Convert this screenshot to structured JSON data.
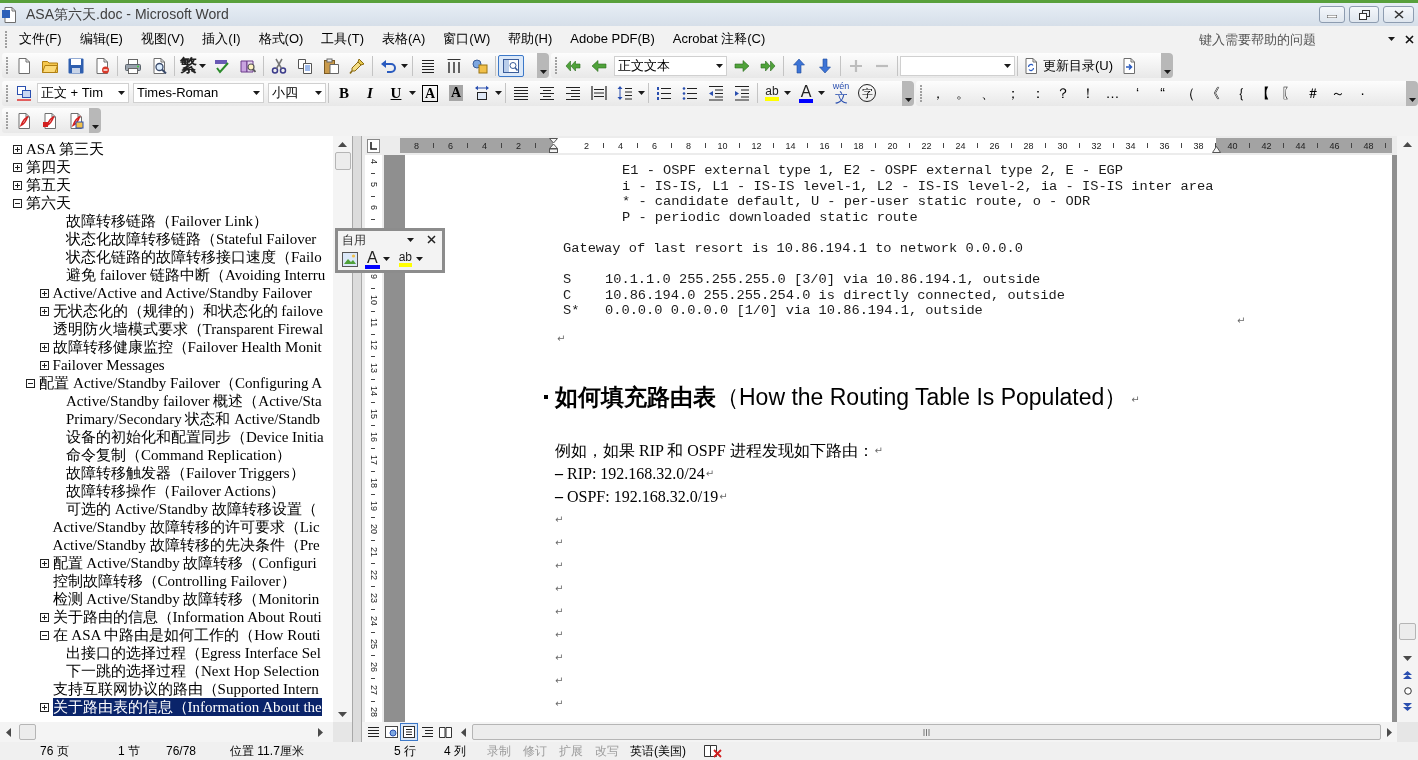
{
  "window": {
    "title": "ASA第六天.doc - Microsoft Word"
  },
  "menu_bar": {
    "items": [
      "文件(F)",
      "编辑(E)",
      "视图(V)",
      "插入(I)",
      "格式(O)",
      "工具(T)",
      "表格(A)",
      "窗口(W)",
      "帮助(H)",
      "Adobe PDF(B)",
      "Acrobat 注释(C)"
    ],
    "help_field": {
      "placeholder": "键入需要帮助的问题"
    }
  },
  "standard_toolbar": {
    "convert_label": "繁",
    "document_map_pressed": true
  },
  "outline_toolbar": {
    "level_style": {
      "value": "正文文本"
    },
    "expand_disabled": true,
    "collapse_disabled": true,
    "update_toc_label": "更新目录(U)"
  },
  "formatting_toolbar": {
    "style": {
      "value": "正文 + Tim"
    },
    "font": {
      "value": "Times-Roman"
    },
    "size": {
      "value": "小四"
    },
    "bold": "B",
    "italic": "I",
    "underline": "U",
    "char_border": "A",
    "char_shading": "A",
    "highlight": "ab",
    "font_color": "A",
    "phonetic_ruby": "wén",
    "phonetic_base": "文",
    "enclose": "字"
  },
  "symbol_toolbar": {
    "symbols": [
      "，",
      "。",
      "、",
      "；",
      "：",
      "？",
      "！",
      "…",
      "‘",
      "“",
      "（",
      "《",
      "｛",
      "【",
      "〖",
      "＃",
      "～",
      "·"
    ]
  },
  "floating_toolbar": {
    "title": "自用",
    "font_color": "A",
    "highlight": "ab"
  },
  "doc_map": {
    "items": [
      {
        "label": "ASA 第三天",
        "expanded": false,
        "selected": false
      },
      {
        "label": "第四天",
        "expanded": false,
        "selected": false
      },
      {
        "label": "第五天",
        "expanded": false,
        "selected": false
      },
      {
        "label": "第六天",
        "expanded": true,
        "selected": false,
        "children": [
          {
            "children": [
              {
                "children": [
                  {
                    "label": "故障转移链路（Failover Link）",
                    "selected": false
                  },
                  {
                    "label": "状态化故障转移链路（Stateful Failover",
                    "selected": false
                  },
                  {
                    "label": "状态化链路的故障转移接口速度（Failo",
                    "selected": false
                  },
                  {
                    "label": "避免 failover 链路中断（Avoiding Interru",
                    "selected": false
                  }
                ]
              },
              {
                "label": "Active/Active and Active/Standby Failover",
                "expanded": false,
                "selected": false
              },
              {
                "label": "无状态化的（规律的）和状态化的 failove",
                "expanded": false,
                "selected": false
              },
              {
                "label": "透明防火墙模式要求（Transparent Firewal",
                "selected": false
              },
              {
                "label": "故障转移健康监控（Failover Health Monit",
                "expanded": false,
                "selected": false
              },
              {
                "label": "Failover Messages",
                "expanded": false,
                "selected": false
              }
            ]
          },
          {
            "label": "配置 Active/Standby Failover（Configuring A",
            "expanded": true,
            "selected": false,
            "children": [
              {
                "children": [
                  {
                    "label": "Active/Standby failover 概述（Active/Sta",
                    "selected": false
                  },
                  {
                    "label": "Primary/Secondary 状态和 Active/Standb",
                    "selected": false
                  },
                  {
                    "label": "设备的初始化和配置同步（Device Initia",
                    "selected": false
                  },
                  {
                    "label": "命令复制（Command Replication）",
                    "selected": false
                  },
                  {
                    "label": "故障转移触发器（Failover Triggers）",
                    "selected": false
                  },
                  {
                    "label": "故障转移操作（Failover Actions）",
                    "selected": false
                  },
                  {
                    "label": "可选的 Active/Standby 故障转移设置（",
                    "selected": false
                  }
                ]
              },
              {
                "label": "Active/Standby 故障转移的许可要求（Lic",
                "selected": false
              },
              {
                "label": "Active/Standby 故障转移的先决条件（Pre",
                "selected": false
              },
              {
                "label": "配置 Active/Standby 故障转移（Configuri",
                "expanded": false,
                "selected": false
              },
              {
                "label": "控制故障转移（Controlling Failover）",
                "selected": false
              },
              {
                "label": "检测 Active/Standby 故障转移（Monitorin",
                "selected": false
              },
              {
                "label": "关于路由的信息（Information About Routi",
                "expanded": false,
                "selected": false
              },
              {
                "label": "在 ASA 中路由是如何工作的（How Routi",
                "expanded": true,
                "selected": false,
                "children": [
                  {
                    "label": "出接口的选择过程（Egress Interface Sel",
                    "selected": false
                  },
                  {
                    "label": "下一跳的选择过程（Next Hop Selection",
                    "selected": false
                  }
                ]
              },
              {
                "label": "支持互联网协议的路由（Supported Intern",
                "selected": false
              },
              {
                "label": "关于路由表的信息（Information About the",
                "expanded": false,
                "selected": true
              }
            ]
          }
        ]
      }
    ]
  },
  "ruler": {
    "left_marks": [
      "8",
      "6",
      "4",
      "2"
    ],
    "marks": [
      "2",
      "4",
      "6",
      "8",
      "10",
      "12",
      "14",
      "16",
      "18",
      "20",
      "22",
      "24",
      "26",
      "28",
      "30",
      "32",
      "34",
      "36",
      "38"
    ],
    "right_marks": [
      "40",
      "42",
      "44",
      "46",
      "48"
    ]
  },
  "vertical_ruler": {
    "upper_marks": [
      "4",
      "5",
      "6"
    ],
    "lower_marks": [
      "9",
      "10",
      "11",
      "12",
      "13",
      "14",
      "15",
      "16",
      "17",
      "18",
      "19",
      "20",
      "21",
      "22",
      "23",
      "24",
      "25",
      "26",
      "27",
      "28"
    ]
  },
  "document": {
    "legend": [
      "E1 - OSPF external type 1, E2 - OSPF external type 2, E - EGP",
      "i - IS-IS, L1 - IS-IS level-1, L2 - IS-IS level-2, ia - IS-IS inter area",
      "* - candidate default, U - per-user static route, o - ODR",
      "P - periodic downloaded static route"
    ],
    "gateway": "Gateway of last resort is 10.86.194.1 to network 0.0.0.0",
    "routes": [
      {
        "code": "S",
        "text": "10.1.1.0 255.255.255.0 [3/0] via 10.86.194.1, outside"
      },
      {
        "code": "C",
        "text": "10.86.194.0 255.255.254.0 is directly connected, outside"
      },
      {
        "code": "S*",
        "text": "0.0.0.0 0.0.0.0 [1/0] via 10.86.194.1, outside"
      }
    ],
    "code_end_mark": "↵",
    "after_code_mark": "↵",
    "heading": {
      "text": "**如何填充路由表**（How the Routing Table Is Populated）",
      "mark": "↵"
    },
    "paragraphs": [
      {
        "text": "例如，如果 RIP 和 OSPF 进程发现如下路由：",
        "mark": "↵"
      },
      {
        "text": "**–** RIP: 192.168.32.0/24",
        "mark": "↵"
      },
      {
        "text": "**–** OSPF: 192.168.32.0/19",
        "mark": "↵"
      }
    ],
    "empty_paragraphs": [
      "↵",
      "↵",
      "↵",
      "↵",
      "↵",
      "↵",
      "↵",
      "↵",
      "↵"
    ]
  },
  "view_buttons": [
    {
      "kind": "normal",
      "selected": false
    },
    {
      "kind": "web",
      "selected": false
    },
    {
      "kind": "print",
      "selected": true
    },
    {
      "kind": "outline",
      "selected": false
    },
    {
      "kind": "reading",
      "selected": false
    }
  ],
  "status_bar": {
    "fields": [
      "76 页",
      "1 节",
      "76/78",
      "位置 11.7厘米",
      "5 行",
      "4 列"
    ],
    "modes": [
      {
        "label": "录制",
        "on": false
      },
      {
        "label": "修订",
        "on": false
      },
      {
        "label": "扩展",
        "on": false
      },
      {
        "label": "改写",
        "on": false
      }
    ],
    "language": "英语(美国)"
  }
}
